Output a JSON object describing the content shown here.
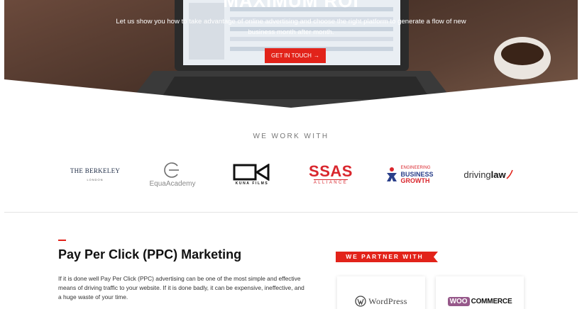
{
  "hero": {
    "headline": "MAXIMUM ROI",
    "subtitle": "Let us show you how to take advantage of online advertising and choose the right platform to generate a flow of new business month after month.",
    "cta_label": "GET IN TOUCH",
    "cta_arrow": "→"
  },
  "partners_strip": {
    "heading": "WE WORK WITH",
    "logos": [
      {
        "name": "THE BERKELEY",
        "tagline": "LONDON"
      },
      {
        "name": "EquaAcademy"
      },
      {
        "name": "KUNA FILMS"
      },
      {
        "name": "SSAS",
        "tagline": "ALLIANCE"
      },
      {
        "line1": "ENGINEERING",
        "line2": "BUSINESS",
        "line3": "GROWTH"
      },
      {
        "part1": "driving",
        "part2": "law"
      }
    ]
  },
  "ppc": {
    "title": "Pay Per Click (PPC) Marketing",
    "body": "If it is done well Pay Per Click (PPC) advertising can be one of the most simple and effective means of driving traffic to your website. If it is done badly, it can be expensive, ineffective, and a huge waste of your time."
  },
  "partner_panel": {
    "banner": "WE PARTNER WITH",
    "cards": [
      {
        "name": "WordPress"
      },
      {
        "badge": "WOO",
        "name": "COMMERCE"
      }
    ]
  },
  "colors": {
    "accent": "#e2231a",
    "woo_purple": "#96588a",
    "navy": "#2a3f8a"
  }
}
